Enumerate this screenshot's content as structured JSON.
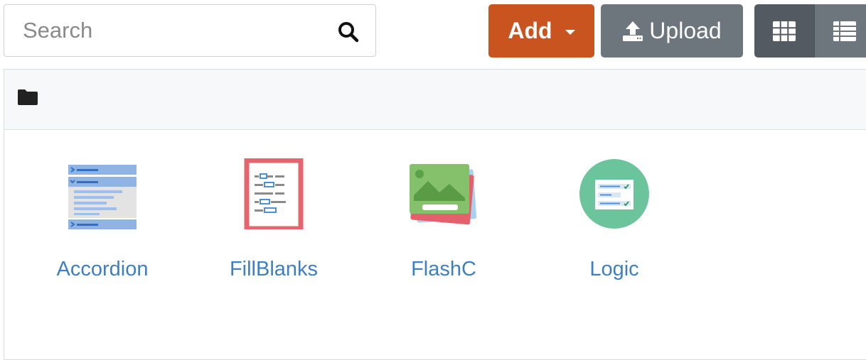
{
  "search": {
    "placeholder": "Search",
    "value": "",
    "icon": "search-icon"
  },
  "toolbar": {
    "add_label": "Add",
    "upload_label": "Upload",
    "add_color": "#c9541f",
    "upload_color": "#6d757d",
    "grid_view_icon": "grid-view-icon",
    "list_view_icon": "list-view-icon",
    "active_view": "grid"
  },
  "breadcrumb": {
    "icon": "folder-icon"
  },
  "items": [
    {
      "label": "Accordion",
      "icon": "accordion-icon"
    },
    {
      "label": "FillBlanks",
      "icon": "fillblanks-icon"
    },
    {
      "label": "FlashC",
      "icon": "flashcards-icon"
    },
    {
      "label": "Logic",
      "icon": "logic-icon"
    }
  ],
  "colors": {
    "link": "#3e7fbf",
    "panel_bg": "#f7f8f9"
  }
}
